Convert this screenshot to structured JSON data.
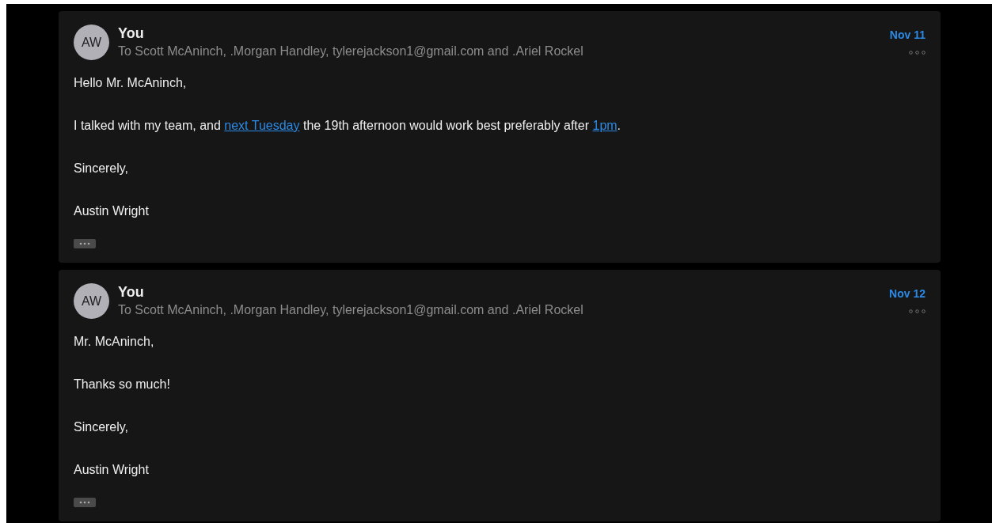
{
  "messages": [
    {
      "avatar": "AW",
      "sender": "You",
      "recipients": "To Scott McAninch, .Morgan Handley, tylerejackson1@gmail.com and .Ariel Rockel",
      "date": "Nov 11",
      "paragraphs": [
        [
          {
            "kind": "text",
            "text": "Hello Mr. McAninch,"
          }
        ],
        [
          {
            "kind": "text",
            "text": "I talked with my team, and "
          },
          {
            "kind": "link",
            "text": "next Tuesday"
          },
          {
            "kind": "text",
            "text": " the 19th afternoon would work best preferably after "
          },
          {
            "kind": "link",
            "text": "1pm"
          },
          {
            "kind": "text",
            "text": "."
          }
        ],
        [
          {
            "kind": "text",
            "text": "Sincerely,"
          }
        ],
        [
          {
            "kind": "text",
            "text": "Austin Wright"
          }
        ]
      ]
    },
    {
      "avatar": "AW",
      "sender": "You",
      "recipients": "To Scott McAninch, .Morgan Handley, tylerejackson1@gmail.com and .Ariel Rockel",
      "date": "Nov 12",
      "paragraphs": [
        [
          {
            "kind": "text",
            "text": "Mr. McAninch,"
          }
        ],
        [
          {
            "kind": "text",
            "text": "Thanks so much!"
          }
        ],
        [
          {
            "kind": "text",
            "text": "Sincerely,"
          }
        ],
        [
          {
            "kind": "text",
            "text": "Austin Wright"
          }
        ]
      ]
    }
  ]
}
